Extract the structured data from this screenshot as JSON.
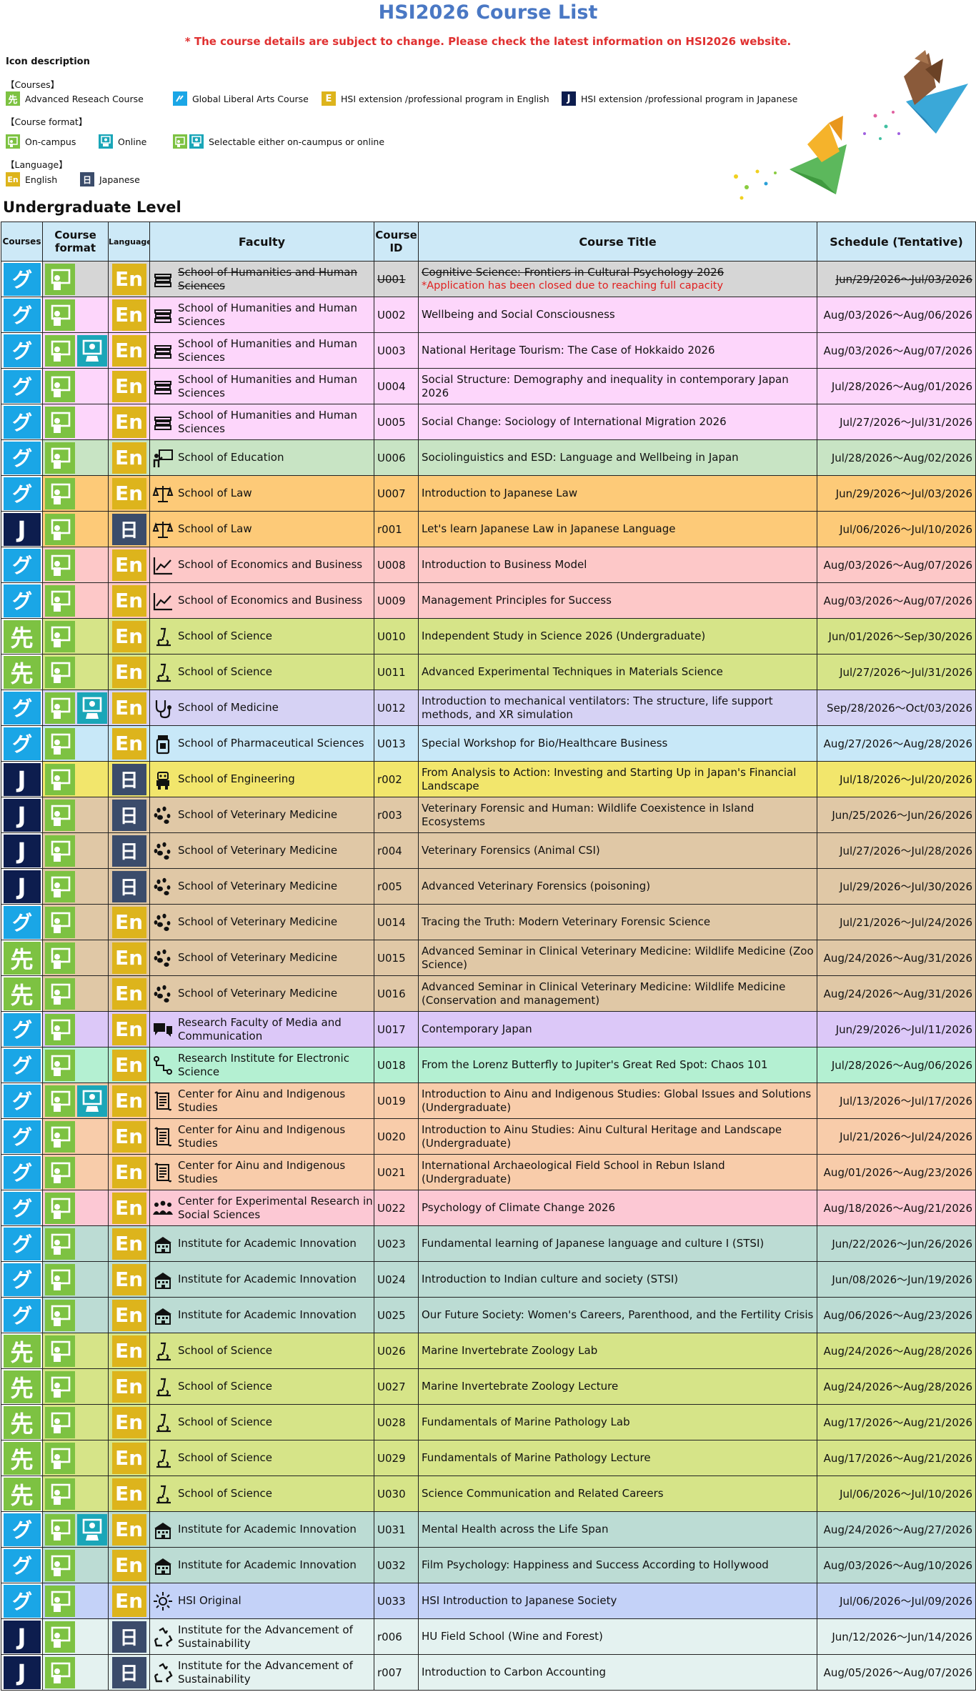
{
  "title": "HSI2026 Course List",
  "notice": "* The course details are subject to change. Please check the latest information on HSI2026 website.",
  "legend": {
    "heading": "Icon description",
    "courses_label": "【Courses】",
    "course_items": [
      {
        "glyph": "先",
        "label": "Advanced Reseach Course"
      },
      {
        "glyph": "グ",
        "label": "Global Liberal Arts Course"
      },
      {
        "glyph": "E",
        "label": "HSI extension /professional program in English"
      },
      {
        "glyph": "J",
        "label": "HSI extension /professional program in Japanese"
      }
    ],
    "format_label": "【Course format】",
    "format_items": [
      {
        "label": "On-campus"
      },
      {
        "label": "Online"
      },
      {
        "label": "Selectable either on-caumpus or online"
      }
    ],
    "language_label": "【Language】",
    "language_items": [
      {
        "glyph": "En",
        "label": "English"
      },
      {
        "glyph": "日",
        "label": "Japanese"
      }
    ]
  },
  "section_title": "Undergraduate Level",
  "columns": {
    "courses": "Courses",
    "format": "Course format",
    "language": "Language",
    "faculty": "Faculty",
    "course_id": "Course ID",
    "title": "Course Title",
    "schedule": "Schedule (Tentative)"
  },
  "colors": {
    "global": "#1aa6e6",
    "advanced": "#7dc242",
    "japanese_program": "#0d1d4e",
    "english": "#ddb41c",
    "japanese": "#3b4c6b",
    "header_bg": "#cde9f7",
    "title": "#4a78c4",
    "notice": "#e03030"
  },
  "rows": [
    {
      "course": "グ",
      "ctype": "gl",
      "formats": [
        "onc"
      ],
      "lang": "En",
      "faculty": "School of Humanities and Human Sciences",
      "icon": "books-icon",
      "id": "U001",
      "title": "Cognitive Science: Frontiers in Cultural Psychology 2026",
      "note": "*Application has been closed due to reaching full capacity",
      "schedule": "Jun/29/2026～Jul/03/2026",
      "bg": "#d6d6d6",
      "closed": true
    },
    {
      "course": "グ",
      "ctype": "gl",
      "formats": [
        "onc"
      ],
      "lang": "En",
      "faculty": "School of Humanities and Human Sciences",
      "icon": "books-icon",
      "id": "U002",
      "title": "Wellbeing and Social Consciousness",
      "schedule": "Aug/03/2026～Aug/06/2026",
      "bg": "#fdd6fb"
    },
    {
      "course": "グ",
      "ctype": "gl",
      "formats": [
        "onc",
        "onl"
      ],
      "lang": "En",
      "faculty": "School of Humanities and Human Sciences",
      "icon": "books-icon",
      "id": "U003",
      "title": "National Heritage Tourism: The Case of Hokkaido 2026",
      "schedule": "Aug/03/2026～Aug/07/2026",
      "bg": "#fdd6fb"
    },
    {
      "course": "グ",
      "ctype": "gl",
      "formats": [
        "onc"
      ],
      "lang": "En",
      "faculty": "School of Humanities and Human Sciences",
      "icon": "books-icon",
      "id": "U004",
      "title": "Social Structure: Demography and inequality in contemporary Japan 2026",
      "schedule": "Jul/28/2026～Aug/01/2026",
      "bg": "#fdd6fb"
    },
    {
      "course": "グ",
      "ctype": "gl",
      "formats": [
        "onc"
      ],
      "lang": "En",
      "faculty": "School of Humanities and Human Sciences",
      "icon": "books-icon",
      "id": "U005",
      "title": "Social Change: Sociology of International Migration 2026",
      "schedule": "Jul/27/2026～Jul/31/2026",
      "bg": "#fdd6fb"
    },
    {
      "course": "グ",
      "ctype": "gl",
      "formats": [
        "onc"
      ],
      "lang": "En",
      "faculty": "School of Education",
      "icon": "teacher-icon",
      "id": "U006",
      "title": "Sociolinguistics and ESD: Language and Wellbeing in Japan",
      "schedule": "Jul/28/2026～Aug/02/2026",
      "bg": "#c8e4c4"
    },
    {
      "course": "グ",
      "ctype": "gl",
      "formats": [
        "onc"
      ],
      "lang": "En",
      "faculty": "School of Law",
      "icon": "scales-icon",
      "id": "U007",
      "title": "Introduction to Japanese Law",
      "schedule": "Jun/29/2026～Jul/03/2026",
      "bg": "#fdca78"
    },
    {
      "course": "J",
      "ctype": "jp",
      "formats": [
        "onc"
      ],
      "lang": "日",
      "faculty": "School of Law",
      "icon": "scales-icon",
      "id": "r001",
      "title": "Let's learn Japanese Law in Japanese Language",
      "schedule": "Jul/06/2026～Jul/10/2026",
      "bg": "#fdca78"
    },
    {
      "course": "グ",
      "ctype": "gl",
      "formats": [
        "onc"
      ],
      "lang": "En",
      "faculty": "School of Economics and Business",
      "icon": "chart-icon",
      "id": "U008",
      "title": "Introduction to Business Model",
      "schedule": "Aug/03/2026～Aug/07/2026",
      "bg": "#fdc8c8"
    },
    {
      "course": "グ",
      "ctype": "gl",
      "formats": [
        "onc"
      ],
      "lang": "En",
      "faculty": "School of Economics and Business",
      "icon": "chart-icon",
      "id": "U009",
      "title": "Management Principles for Success",
      "schedule": "Aug/03/2026～Aug/07/2026",
      "bg": "#fdc8c8"
    },
    {
      "course": "先",
      "ctype": "adv",
      "formats": [
        "onc"
      ],
      "lang": "En",
      "faculty": "School of Science",
      "icon": "microscope-icon",
      "id": "U010",
      "title": "Independent Study in Science 2026 (Undergraduate)",
      "schedule": "Jun/01/2026～Sep/30/2026",
      "bg": "#d6e488"
    },
    {
      "course": "先",
      "ctype": "adv",
      "formats": [
        "onc"
      ],
      "lang": "En",
      "faculty": "School of Science",
      "icon": "microscope-icon",
      "id": "U011",
      "title": "Advanced Experimental Techniques in Materials Science",
      "schedule": "Jul/27/2026～Jul/31/2026",
      "bg": "#d6e488"
    },
    {
      "course": "グ",
      "ctype": "gl",
      "formats": [
        "onc",
        "onl"
      ],
      "lang": "En",
      "faculty": "School of Medicine",
      "icon": "stethoscope-icon",
      "id": "U012",
      "title": "Introduction to mechanical ventilators: The structure, life support methods, and XR simulation",
      "schedule": "Sep/28/2026～Oct/03/2026",
      "bg": "#d6d2f4"
    },
    {
      "course": "グ",
      "ctype": "gl",
      "formats": [
        "onc"
      ],
      "lang": "En",
      "faculty": "School of Pharmaceutical Sciences",
      "icon": "pill-bottle-icon",
      "id": "U013",
      "title": "Special Workshop for Bio/Healthcare Business",
      "schedule": "Aug/27/2026～Aug/28/2026",
      "bg": "#c8e8f8"
    },
    {
      "course": "J",
      "ctype": "jp",
      "formats": [
        "onc"
      ],
      "lang": "日",
      "faculty": "School of Engineering",
      "icon": "robot-icon",
      "id": "r002",
      "title": "From Analysis to Action: Investing and Starting Up in Japan's Financial Landscape",
      "schedule": "Jul/18/2026～Jul/20/2026",
      "bg": "#f2e66c"
    },
    {
      "course": "J",
      "ctype": "jp",
      "formats": [
        "onc"
      ],
      "lang": "日",
      "faculty": "School of Veterinary Medicine",
      "icon": "paw-icon",
      "id": "r003",
      "title": "Veterinary Forensic and Human: Wildlife Coexistence in Island Ecosystems",
      "schedule": "Jun/25/2026～Jun/26/2026",
      "bg": "#e0c8a6"
    },
    {
      "course": "J",
      "ctype": "jp",
      "formats": [
        "onc"
      ],
      "lang": "日",
      "faculty": "School of Veterinary Medicine",
      "icon": "paw-icon",
      "id": "r004",
      "title": "Veterinary Forensics (Animal CSI)",
      "schedule": "Jul/27/2026～Jul/28/2026",
      "bg": "#e0c8a6"
    },
    {
      "course": "J",
      "ctype": "jp",
      "formats": [
        "onc"
      ],
      "lang": "日",
      "faculty": "School of Veterinary Medicine",
      "icon": "paw-icon",
      "id": "r005",
      "title": "Advanced Veterinary Forensics (poisoning)",
      "schedule": "Jul/29/2026～Jul/30/2026",
      "bg": "#e0c8a6"
    },
    {
      "course": "グ",
      "ctype": "gl",
      "formats": [
        "onc"
      ],
      "lang": "En",
      "faculty": "School of Veterinary Medicine",
      "icon": "paw-icon",
      "id": "U014",
      "title": "Tracing the Truth: Modern Veterinary Forensic Science",
      "schedule": "Jul/21/2026～Jul/24/2026",
      "bg": "#e0c8a6"
    },
    {
      "course": "先",
      "ctype": "adv",
      "formats": [
        "onc"
      ],
      "lang": "En",
      "faculty": "School of Veterinary Medicine",
      "icon": "paw-icon",
      "id": "U015",
      "title": "Advanced Seminar in Clinical Veterinary Medicine: Wildlife Medicine (Zoo Science)",
      "schedule": "Aug/24/2026～Aug/31/2026",
      "bg": "#e0c8a6"
    },
    {
      "course": "先",
      "ctype": "adv",
      "formats": [
        "onc"
      ],
      "lang": "En",
      "faculty": "School of Veterinary Medicine",
      "icon": "paw-icon",
      "id": "U016",
      "title": "Advanced Seminar in Clinical Veterinary Medicine: Wildlife Medicine (Conservation and management)",
      "schedule": "Aug/24/2026～Aug/31/2026",
      "bg": "#e0c8a6"
    },
    {
      "course": "グ",
      "ctype": "gl",
      "formats": [
        "onc"
      ],
      "lang": "En",
      "faculty": "Research Faculty of Media and Communication",
      "icon": "speech-bubbles-icon",
      "id": "U017",
      "title": "Contemporary Japan",
      "schedule": "Jun/29/2026～Jul/11/2026",
      "bg": "#dcc8f8"
    },
    {
      "course": "グ",
      "ctype": "gl",
      "formats": [
        "onc"
      ],
      "lang": "En",
      "faculty": "Research Institute for Electronic Science",
      "icon": "circuit-icon",
      "id": "U018",
      "title": "From the Lorenz Butterfly to Jupiter's Great Red Spot: Chaos 101",
      "schedule": "Jul/28/2026～Aug/06/2026",
      "bg": "#b4f0d2"
    },
    {
      "course": "グ",
      "ctype": "gl",
      "formats": [
        "onc",
        "onl"
      ],
      "lang": "En",
      "faculty": "Center for Ainu and Indigenous Studies",
      "icon": "scroll-icon",
      "id": "U019",
      "title": "Introduction to Ainu and Indigenous Studies: Global Issues and Solutions (Undergraduate)",
      "schedule": "Jul/13/2026～Jul/17/2026",
      "bg": "#f8ccaa"
    },
    {
      "course": "グ",
      "ctype": "gl",
      "formats": [
        "onc"
      ],
      "lang": "En",
      "faculty": "Center for Ainu and Indigenous Studies",
      "icon": "scroll-icon",
      "id": "U020",
      "title": "Introduction to Ainu Studies: Ainu Cultural Heritage and Landscape (Undergraduate)",
      "schedule": "Jul/21/2026～Jul/24/2026",
      "bg": "#f8ccaa"
    },
    {
      "course": "グ",
      "ctype": "gl",
      "formats": [
        "onc"
      ],
      "lang": "En",
      "faculty": "Center for Ainu and Indigenous Studies",
      "icon": "scroll-icon",
      "id": "U021",
      "title": "International Archaeological Field School in Rebun Island (Undergraduate)",
      "schedule": "Aug/01/2026～Aug/23/2026",
      "bg": "#f8ccaa"
    },
    {
      "course": "グ",
      "ctype": "gl",
      "formats": [
        "onc"
      ],
      "lang": "En",
      "faculty": "Center for Experimental Research in Social Sciences",
      "icon": "people-icon",
      "id": "U022",
      "title": "Psychology of Climate Change 2026",
      "schedule": "Aug/18/2026～Aug/21/2026",
      "bg": "#fcc8d4"
    },
    {
      "course": "グ",
      "ctype": "gl",
      "formats": [
        "onc"
      ],
      "lang": "En",
      "faculty": "Institute for Academic Innovation",
      "icon": "building-icon",
      "id": "U023",
      "title": "Fundamental learning of Japanese language and culture I (STSI)",
      "schedule": "Jun/22/2026～Jun/26/2026",
      "bg": "#bcdcd4"
    },
    {
      "course": "グ",
      "ctype": "gl",
      "formats": [
        "onc"
      ],
      "lang": "En",
      "faculty": "Institute for Academic Innovation",
      "icon": "building-icon",
      "id": "U024",
      "title": "Introduction to Indian culture and society (STSI)",
      "schedule": "Jun/08/2026～Jun/19/2026",
      "bg": "#bcdcd4"
    },
    {
      "course": "グ",
      "ctype": "gl",
      "formats": [
        "onc"
      ],
      "lang": "En",
      "faculty": "Institute for Academic Innovation",
      "icon": "building-icon",
      "id": "U025",
      "title": "Our Future Society: Women's Careers, Parenthood, and the Fertility Crisis",
      "schedule": "Aug/06/2026～Aug/23/2026",
      "bg": "#bcdcd4"
    },
    {
      "course": "先",
      "ctype": "adv",
      "formats": [
        "onc"
      ],
      "lang": "En",
      "faculty": "School of Science",
      "icon": "microscope-icon",
      "id": "U026",
      "title": "Marine Invertebrate Zoology Lab",
      "schedule": "Aug/24/2026～Aug/28/2026",
      "bg": "#d6e488"
    },
    {
      "course": "先",
      "ctype": "adv",
      "formats": [
        "onc"
      ],
      "lang": "En",
      "faculty": "School of Science",
      "icon": "microscope-icon",
      "id": "U027",
      "title": "Marine Invertebrate Zoology Lecture",
      "schedule": "Aug/24/2026～Aug/28/2026",
      "bg": "#d6e488"
    },
    {
      "course": "先",
      "ctype": "adv",
      "formats": [
        "onc"
      ],
      "lang": "En",
      "faculty": "School of Science",
      "icon": "microscope-icon",
      "id": "U028",
      "title": "Fundamentals of Marine Pathology Lab",
      "schedule": "Aug/17/2026～Aug/21/2026",
      "bg": "#d6e488"
    },
    {
      "course": "先",
      "ctype": "adv",
      "formats": [
        "onc"
      ],
      "lang": "En",
      "faculty": "School of Science",
      "icon": "microscope-icon",
      "id": "U029",
      "title": "Fundamentals of Marine Pathology Lecture",
      "schedule": "Aug/17/2026～Aug/21/2026",
      "bg": "#d6e488"
    },
    {
      "course": "先",
      "ctype": "adv",
      "formats": [
        "onc"
      ],
      "lang": "En",
      "faculty": "School of Science",
      "icon": "microscope-icon",
      "id": "U030",
      "title": "Science Communication and Related Careers",
      "schedule": "Jul/06/2026～Jul/10/2026",
      "bg": "#d6e488"
    },
    {
      "course": "グ",
      "ctype": "gl",
      "formats": [
        "onc",
        "onl"
      ],
      "lang": "En",
      "faculty": "Institute for Academic Innovation",
      "icon": "building-icon",
      "id": "U031",
      "title": "Mental Health across the Life Span",
      "schedule": "Aug/24/2026～Aug/27/2026",
      "bg": "#bcdcd4"
    },
    {
      "course": "グ",
      "ctype": "gl",
      "formats": [
        "onc"
      ],
      "lang": "En",
      "faculty": "Institute for Academic Innovation",
      "icon": "building-icon",
      "id": "U032",
      "title": "Film Psychology: Happiness and Success According to Hollywood",
      "schedule": "Aug/03/2026～Aug/10/2026",
      "bg": "#bcdcd4"
    },
    {
      "course": "グ",
      "ctype": "gl",
      "formats": [
        "onc"
      ],
      "lang": "En",
      "faculty": "HSI Original",
      "icon": "sun-icon",
      "id": "U033",
      "title": "HSI Introduction to Japanese Society",
      "schedule": "Jul/06/2026～Jul/09/2026",
      "bg": "#c4d2f8"
    },
    {
      "course": "J",
      "ctype": "jp",
      "formats": [
        "onc"
      ],
      "lang": "日",
      "faculty": "Institute for the Advancement of Sustainability",
      "icon": "recycle-icon",
      "id": "r006",
      "title": "HU Field School (Wine and Forest)",
      "schedule": "Jun/12/2026～Jun/14/2026",
      "bg": "#e4f2f0"
    },
    {
      "course": "J",
      "ctype": "jp",
      "formats": [
        "onc"
      ],
      "lang": "日",
      "faculty": "Institute for the Advancement of Sustainability",
      "icon": "recycle-icon",
      "id": "r007",
      "title": "Introduction to Carbon Accounting",
      "schedule": "Aug/05/2026～Aug/07/2026",
      "bg": "#e4f2f0"
    }
  ]
}
